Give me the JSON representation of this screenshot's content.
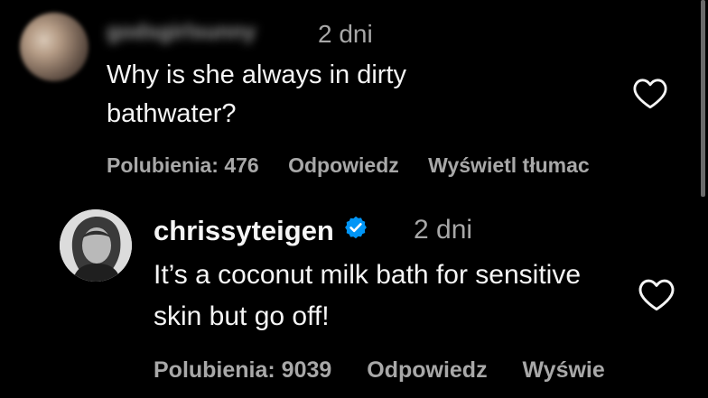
{
  "comments": [
    {
      "username": "godsgirlsunny",
      "time": "2 dni",
      "text": "Why is she always in dirty bathwater?",
      "likes": "Polubienia: 476",
      "reply": "Odpowiedz",
      "translate": "Wyświetl tłumac"
    },
    {
      "username": "chrissyteigen",
      "time": "2 dni",
      "text": "It’s a coconut milk bath for sensitive skin but go off!",
      "likes": "Polubienia: 9039",
      "reply": "Odpowiedz",
      "translate": "Wyświe"
    }
  ],
  "colors": {
    "background": "#000000",
    "text_primary": "#f5f5f5",
    "text_secondary": "#a8a8a8",
    "verified_badge": "#0095f6"
  },
  "icons": [
    "heart-icon",
    "verified-badge-icon"
  ]
}
